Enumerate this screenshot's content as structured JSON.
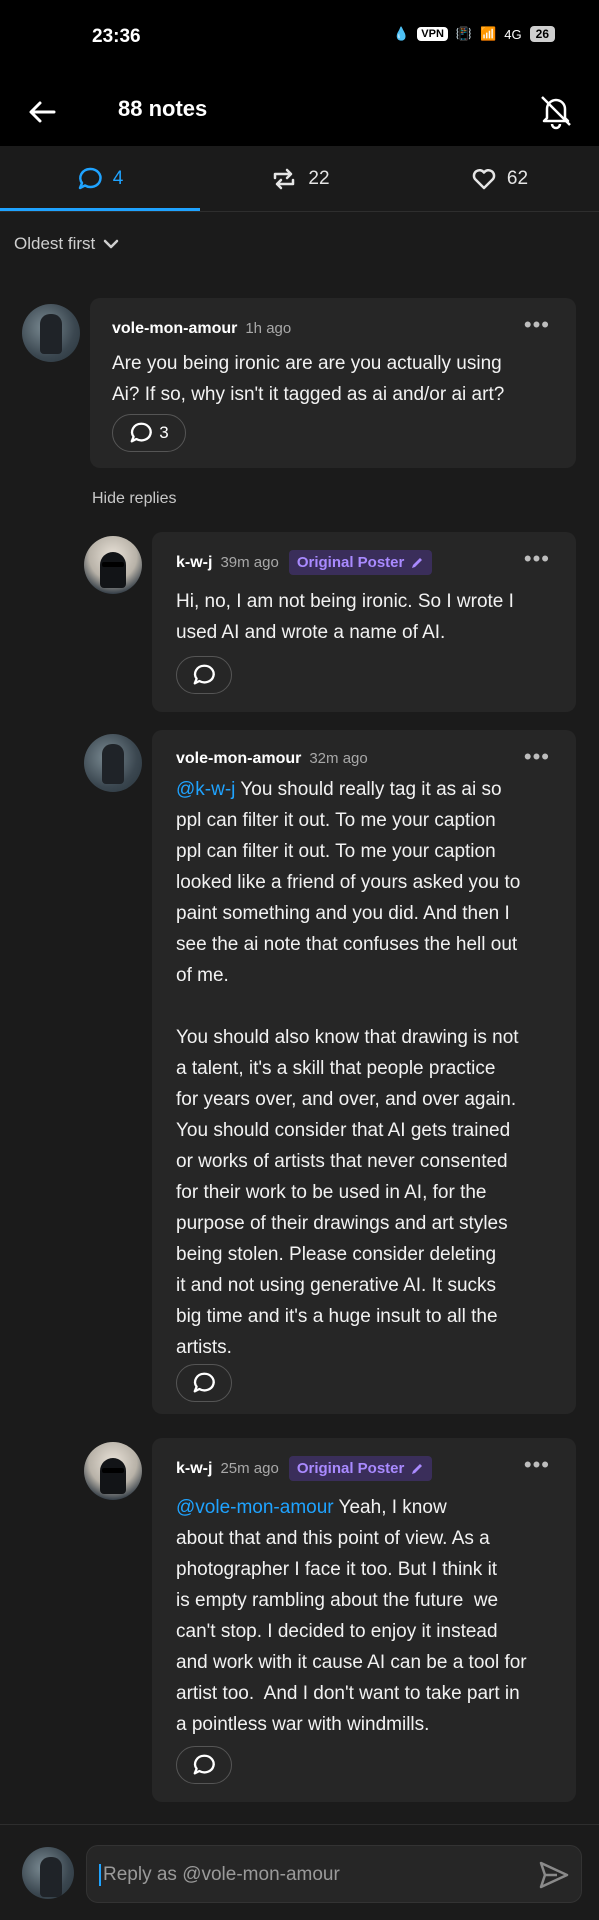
{
  "status_bar": {
    "time": "23:36",
    "vpn": "VPN",
    "network": "4G",
    "battery": "26"
  },
  "header": {
    "title": "88 notes"
  },
  "tabs": [
    {
      "icon": "comment-icon",
      "count": "4"
    },
    {
      "icon": "reblog-icon",
      "count": "22"
    },
    {
      "icon": "heart-icon",
      "count": "62"
    }
  ],
  "sort": {
    "label": "Oldest first"
  },
  "hide_replies": "Hide replies",
  "comments": [
    {
      "user": "vole-mon-amour",
      "ago": "1h ago",
      "body": "Are you being ironic are are you actually using\nAi? If so, why isn't it tagged as ai and/or ai art?",
      "reply_count": "3"
    },
    {
      "user": "k-w-j",
      "ago": "39m ago",
      "badge": "Original Poster",
      "body": "Hi, no, I am not being ironic. So I wrote I\nused AI and wrote a name of AI."
    },
    {
      "user": "vole-mon-amour",
      "ago": "32m ago",
      "mention": "@k-w-j",
      "body": " You should really tag it as ai so\nppl can filter it out. To me your caption\nppl can filter it out. To me your caption\nlooked like a friend of yours asked you to\npaint something and you did. And then I\nsee the ai note that confuses the hell out\nof me.\n\nYou should also know that drawing is not\na talent, it's a skill that people practice\nfor years over, and over, and over again.\nYou should consider that AI gets trained\nor works of artists that never consented\nfor their work to be used in AI, for the\npurpose of their drawings and art styles\nbeing stolen. Please consider deleting\nit and not using generative AI. It sucks\nbig time and it's a huge insult to all the\nartists."
    },
    {
      "user": "k-w-j",
      "ago": "25m ago",
      "badge": "Original Poster",
      "mention": "@vole-mon-amour",
      "body": " Yeah, I know\nabout that and this point of view. As a\nphotographer I face it too. But I think it\nis empty rambling about the future  we\ncan't stop. I decided to enjoy it instead\nand work with it cause AI can be a tool for\nartist too.  And I don't want to take part in\na pointless war with windmills."
    }
  ],
  "composer": {
    "placeholder": "Reply as @vole-mon-amour"
  }
}
